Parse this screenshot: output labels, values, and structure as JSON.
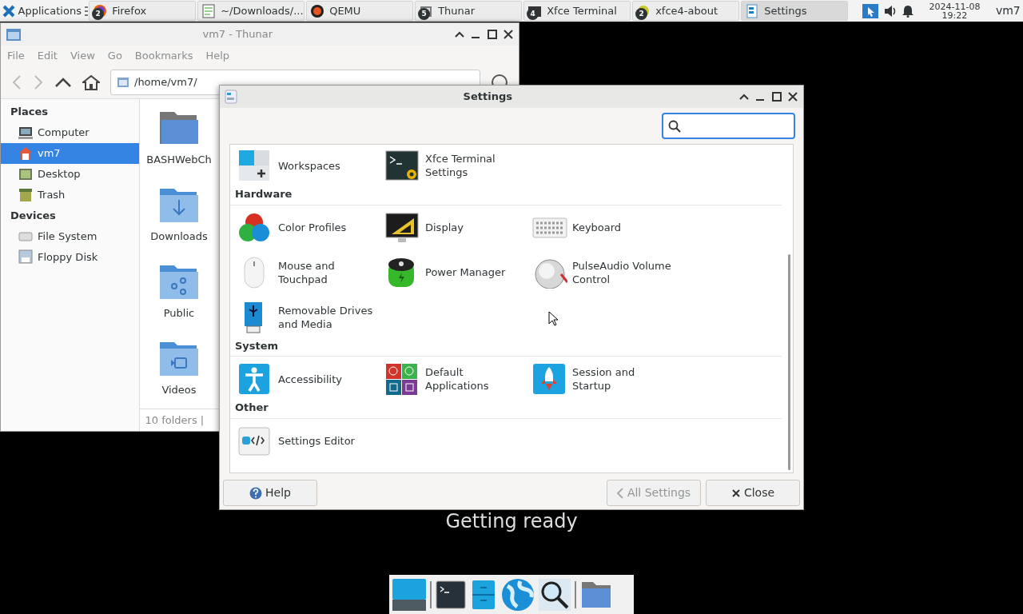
{
  "panel": {
    "menu_label": "Applications",
    "tasks": [
      {
        "label": "Firefox",
        "badge": "2",
        "selected": false
      },
      {
        "label": "~/Downloads/...",
        "selected": false
      },
      {
        "label": "QEMU",
        "selected": false
      },
      {
        "label": "Thunar",
        "badge": "5",
        "selected": false
      },
      {
        "label": "Xfce Terminal",
        "badge": "4",
        "selected": false
      },
      {
        "label": "xfce4-about",
        "badge": "2",
        "selected": false
      },
      {
        "label": "Settings",
        "selected": true
      }
    ],
    "clock": {
      "date": "2024-11-08",
      "time": "19:22"
    },
    "user": "vm7"
  },
  "file_manager": {
    "title": "vm7 - Thunar",
    "menu": [
      "File",
      "Edit",
      "View",
      "Go",
      "Bookmarks",
      "Help"
    ],
    "path": "/home/vm7/",
    "sidebar": [
      {
        "heading": "Places",
        "items": [
          {
            "label": "Computer",
            "selected": false
          },
          {
            "label": "vm7",
            "selected": true
          },
          {
            "label": "Desktop",
            "selected": false
          },
          {
            "label": "Trash",
            "selected": false
          }
        ]
      },
      {
        "heading": "Devices",
        "items": [
          {
            "label": "File System",
            "selected": false
          },
          {
            "label": "Floppy Disk",
            "selected": false
          }
        ]
      }
    ],
    "files": [
      "BASHWebCh",
      "Downloads",
      "Public",
      "Videos"
    ],
    "status": "10 folders |"
  },
  "settings": {
    "title": "Settings",
    "search": {
      "focused": true
    },
    "sections": [
      {
        "items": [
          {
            "label": "Workspaces"
          },
          {
            "label": "Xfce Terminal\nSettings"
          }
        ]
      },
      {
        "heading": "Hardware",
        "items": [
          {
            "label": "Color Profiles"
          },
          {
            "label": "Display"
          },
          {
            "label": "Keyboard"
          },
          {
            "label": "Mouse and\nTouchpad"
          },
          {
            "label": "Power Manager"
          },
          {
            "label": "PulseAudio Volume\nControl"
          },
          {
            "label": "Removable Drives\nand Media"
          }
        ]
      },
      {
        "heading": "System",
        "items": [
          {
            "label": "Accessibility"
          },
          {
            "label": "Default\nApplications"
          },
          {
            "label": "Session and\nStartup"
          }
        ]
      },
      {
        "heading": "Other",
        "items": [
          {
            "label": "Settings Editor"
          }
        ]
      }
    ],
    "buttons": [
      {
        "label": "Help",
        "kind": "help",
        "disabled": false
      },
      {
        "label": "All Settings",
        "kind": "back",
        "disabled": true
      },
      {
        "label": "Close",
        "kind": "close",
        "disabled": false
      }
    ]
  },
  "overlay_text": "Getting ready"
}
